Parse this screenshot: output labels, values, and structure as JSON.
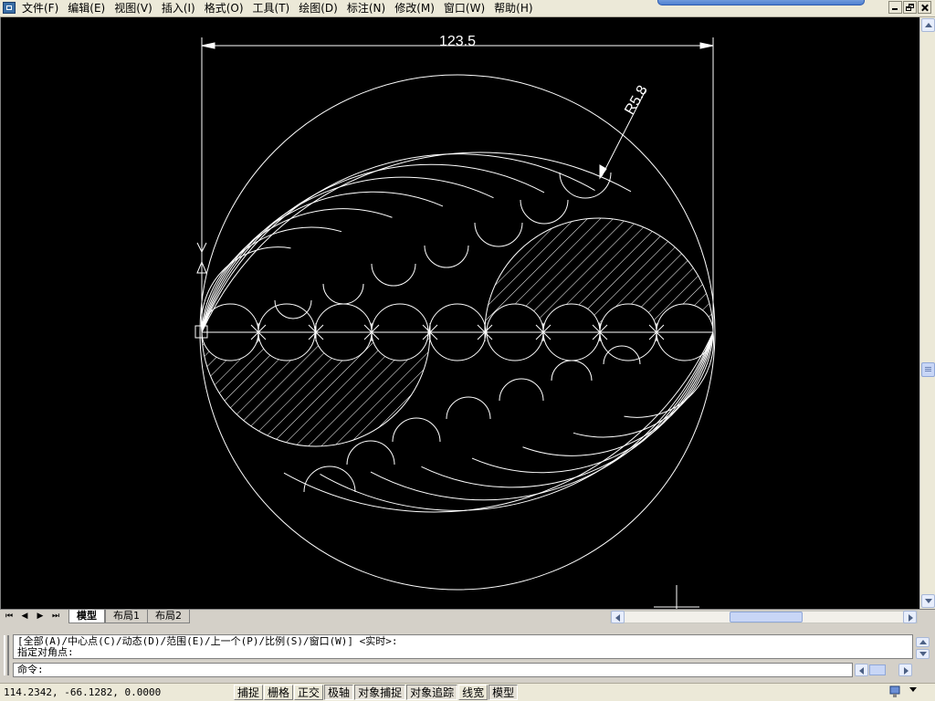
{
  "menubar": {
    "items": [
      "文件(F)",
      "编辑(E)",
      "视图(V)",
      "插入(I)",
      "格式(O)",
      "工具(T)",
      "绘图(D)",
      "标注(N)",
      "修改(M)",
      "窗口(W)",
      "帮助(H)"
    ]
  },
  "drawing": {
    "dimension_label": "123.5",
    "radius_label": "R5.8"
  },
  "layout_tabs": {
    "tabs": [
      "模型",
      "布局1",
      "布局2"
    ],
    "active": "模型"
  },
  "command_window": {
    "history_line1": "[全部(A)/中心点(C)/动态(D)/范围(E)/上一个(P)/比例(S)/窗口(W)] <实时>:",
    "history_line2": "指定对角点:",
    "prompt": "命令:"
  },
  "status_bar": {
    "coordinates": "114.2342,  -66.1282,  0.0000",
    "modes": [
      {
        "label": "捕捉",
        "on": false
      },
      {
        "label": "栅格",
        "on": false
      },
      {
        "label": "正交",
        "on": false
      },
      {
        "label": "极轴",
        "on": true
      },
      {
        "label": "对象捕捉",
        "on": true
      },
      {
        "label": "对象追踪",
        "on": true
      },
      {
        "label": "线宽",
        "on": false
      },
      {
        "label": "模型",
        "on": true
      }
    ]
  },
  "colors": {
    "canvas_background": "#000000",
    "geometry": "#ffffff"
  }
}
